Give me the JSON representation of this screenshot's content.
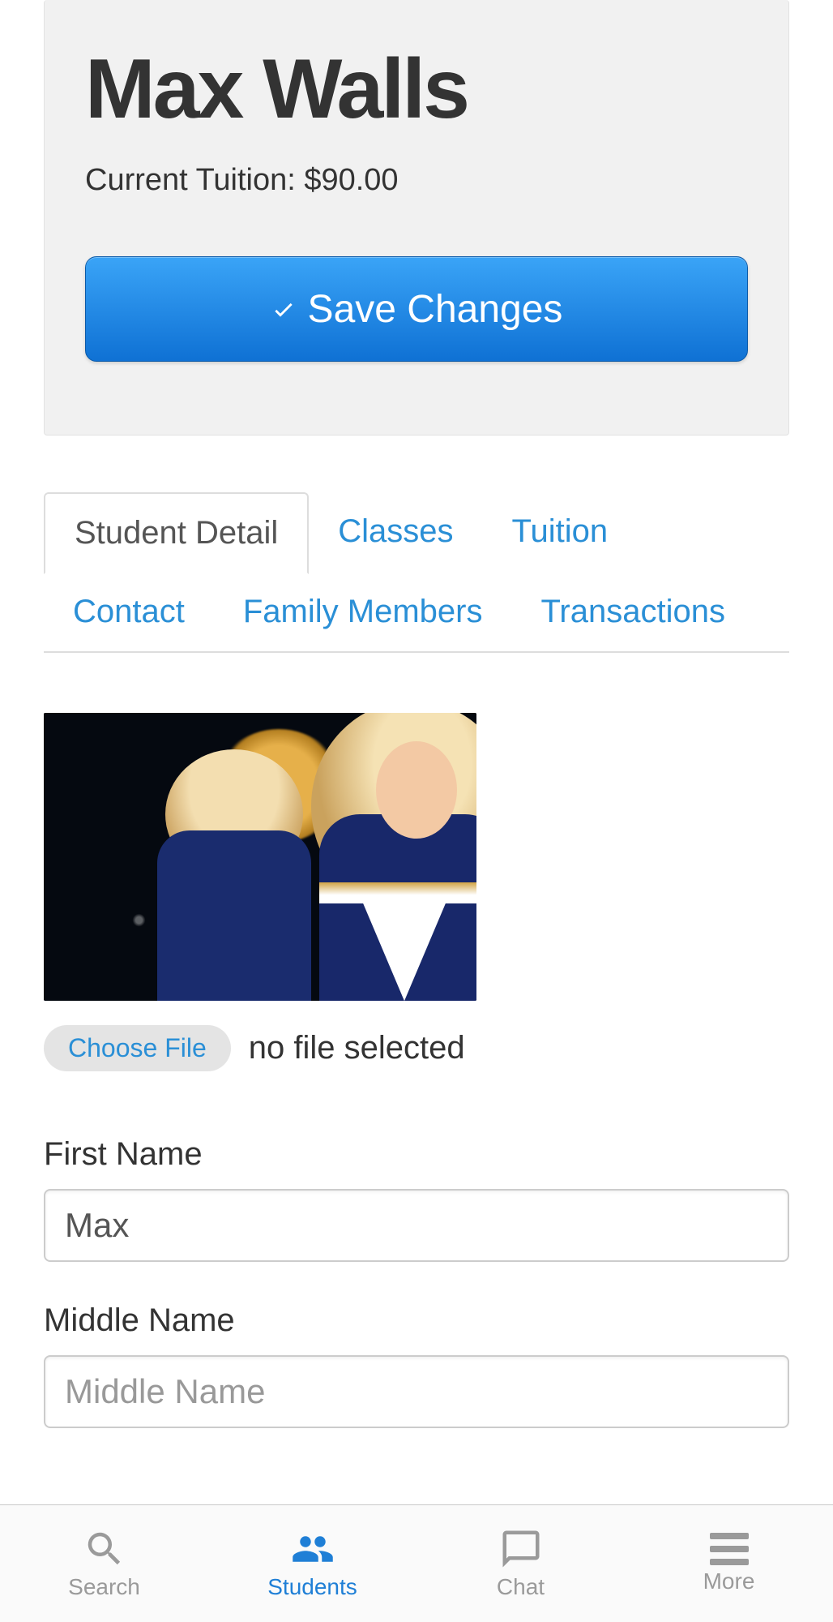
{
  "header": {
    "student_name": "Max Walls",
    "tuition_label": "Current Tuition: $90.00",
    "save_label": "Save Changes"
  },
  "tabs": {
    "student_detail": "Student Detail",
    "classes": "Classes",
    "tuition": "Tuition",
    "contact": "Contact",
    "family_members": "Family Members",
    "transactions": "Transactions"
  },
  "file_picker": {
    "choose_label": "Choose File",
    "status": "no file selected"
  },
  "form": {
    "first_name_label": "First Name",
    "first_name_value": "Max",
    "middle_name_label": "Middle Name",
    "middle_name_value": "",
    "middle_name_placeholder": "Middle Name"
  },
  "nav": {
    "search": "Search",
    "students": "Students",
    "chat": "Chat",
    "more": "More"
  }
}
